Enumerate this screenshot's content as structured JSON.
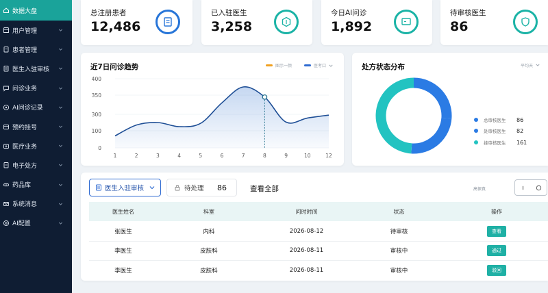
{
  "sidebar": {
    "items": [
      {
        "label": "数据大盘",
        "icon": "home-icon",
        "active": true,
        "chevron": false
      },
      {
        "label": "用户管理",
        "icon": "store-icon",
        "chevron": true
      },
      {
        "label": "患者管理",
        "icon": "clipboard-icon",
        "chevron": true
      },
      {
        "label": "医生入驻审核",
        "icon": "document-icon",
        "chevron": true
      },
      {
        "label": "问诊业务",
        "icon": "chat-icon",
        "chevron": true
      },
      {
        "label": "AI问诊记录",
        "icon": "ai-icon",
        "chevron": true
      },
      {
        "label": "预约挂号",
        "icon": "calendar-icon",
        "chevron": true
      },
      {
        "label": "医疗业务",
        "icon": "medical-icon",
        "chevron": true
      },
      {
        "label": "电子处方",
        "icon": "prescription-icon",
        "chevron": true
      },
      {
        "label": "药品库",
        "icon": "pill-icon",
        "chevron": true
      },
      {
        "label": "系统消息",
        "icon": "message-icon",
        "chevron": true
      },
      {
        "label": "AI配置",
        "icon": "settings-icon",
        "chevron": true
      }
    ]
  },
  "stats": [
    {
      "label": "总注册患者",
      "value": "12,486",
      "icon": "ledger-icon"
    },
    {
      "label": "已入驻医生",
      "value": "3,258",
      "icon": "hex-icon"
    },
    {
      "label": "今日AI问诊",
      "value": "1,892",
      "icon": "monitor-icon"
    },
    {
      "label": "待审核医生",
      "value": "86",
      "icon": "shield-icon"
    }
  ],
  "trend": {
    "title": "近7日问诊趋势",
    "legend": [
      {
        "name": "图示一颜",
        "color": "#f0a020"
      },
      {
        "name": "医考口",
        "color": "#2f6bd1"
      }
    ]
  },
  "chart_data": {
    "type": "area",
    "x": [
      1,
      2,
      3,
      4,
      5,
      6,
      7,
      8,
      9,
      10,
      12
    ],
    "ylim": [
      0,
      400
    ],
    "yticks": [
      0,
      100,
      200,
      250,
      300,
      350,
      400
    ],
    "xticks": [
      "1",
      "2",
      "3",
      "4",
      "5",
      "6",
      "7",
      "8",
      "9",
      "10",
      "12"
    ],
    "series": [
      {
        "values": [
          70,
          170,
          200,
          150,
          190,
          330,
          375,
          345,
          205,
          255,
          290
        ],
        "color": "#1f4f96"
      }
    ],
    "highlight_index": 7
  },
  "distribution": {
    "title": "处方状态分布",
    "dropdown": "平均天",
    "chart": {
      "type": "pie",
      "values": [
        86,
        82,
        161
      ],
      "colors": [
        "#2b7be4",
        "#2b7be4",
        "#22c3c1"
      ]
    },
    "legend": [
      {
        "label": "总审核医生",
        "value": "86",
        "color": "#2b7be4"
      },
      {
        "label": "处审核医生",
        "value": "82",
        "color": "#2b7be4"
      },
      {
        "label": "挂审核医生",
        "value": "161",
        "color": "#22c3c1"
      }
    ]
  },
  "review": {
    "filter_label": "医生入驻审核",
    "pending_label": "待处理",
    "pending_count": "86",
    "view_all": "查看全部",
    "hint": "高保真",
    "columns": [
      "医生姓名",
      "科室",
      "问时时间",
      "状态",
      "操作"
    ],
    "rows": [
      {
        "name": "张医生",
        "dept": "内科",
        "date": "2026-08-12",
        "status": "待审核",
        "action": "查看"
      },
      {
        "name": "李医生",
        "dept": "皮肤科",
        "date": "2026-08-11",
        "status": "审核中",
        "action": "通过"
      },
      {
        "name": "李医生",
        "dept": "皮肤科",
        "date": "2026-08-11",
        "status": "审核中",
        "action": "驳回"
      }
    ]
  }
}
